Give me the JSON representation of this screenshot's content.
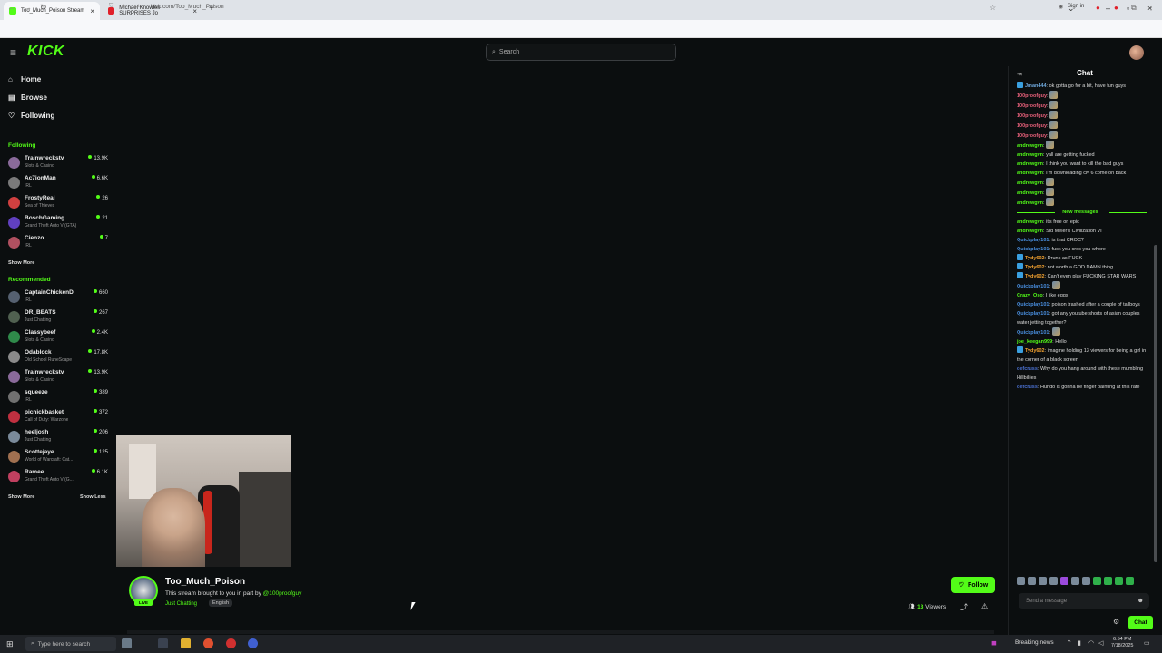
{
  "browser": {
    "tabs": [
      {
        "title": "Too_Much_Poison Stream",
        "favicon_color": "#53fc18",
        "active": true
      },
      {
        "title": "Michael Knowles SURPRISES Jo",
        "favicon_color": "#e0202a",
        "active": false
      }
    ],
    "new_tab": "+",
    "url": "kick.com/Too_Much_Poison",
    "sign_in": "Sign in"
  },
  "topnav": {
    "logo": "KICK",
    "search_placeholder": "Search"
  },
  "sidebar": {
    "nav": [
      {
        "label": "Home",
        "icon": "home-icon"
      },
      {
        "label": "Browse",
        "icon": "browse-icon"
      },
      {
        "label": "Following",
        "icon": "heart-icon"
      }
    ],
    "following_heading": "Following",
    "following": [
      {
        "name": "Trainwreckstv",
        "category": "Slots & Casino",
        "viewers": "13.9K",
        "color": "#8a6a9a"
      },
      {
        "name": "Ac7ionMan",
        "category": "IRL",
        "viewers": "6.6K",
        "color": "#7a7a7a"
      },
      {
        "name": "FrostyReal",
        "category": "Sea of Thieves",
        "viewers": "26",
        "color": "#d04040"
      },
      {
        "name": "BoschGaming",
        "category": "Grand Theft Auto V (GTA)",
        "viewers": "21",
        "color": "#6040c0"
      },
      {
        "name": "Cienzo",
        "category": "IRL",
        "viewers": "7",
        "color": "#b05060"
      }
    ],
    "following_show_more": "Show More",
    "recommended_heading": "Recommended",
    "recommended": [
      {
        "name": "CaptainChickenD",
        "category": "IRL",
        "viewers": "660",
        "color": "#556070"
      },
      {
        "name": "DR_BEATS",
        "category": "Just Chatting",
        "viewers": "267",
        "color": "#506050"
      },
      {
        "name": "Classybeef",
        "category": "Slots & Casino",
        "viewers": "2.4K",
        "color": "#2f8a4a"
      },
      {
        "name": "Odablock",
        "category": "Old School RuneScape",
        "viewers": "17.8K",
        "color": "#8a8a8a"
      },
      {
        "name": "Trainwreckstv",
        "category": "Slots & Casino",
        "viewers": "13.9K",
        "color": "#8a6a9a"
      },
      {
        "name": "squeeze",
        "category": "IRL",
        "viewers": "389",
        "color": "#707070"
      },
      {
        "name": "picnickbasket",
        "category": "Call of Duty: Warzone",
        "viewers": "372",
        "color": "#c03040"
      },
      {
        "name": "heeljosh",
        "category": "Just Chatting",
        "viewers": "206",
        "color": "#7a8a9a"
      },
      {
        "name": "Scottejaye",
        "category": "World of Warcraft: Cat...",
        "viewers": "125",
        "color": "#a07050"
      },
      {
        "name": "Ramee",
        "category": "Grand Theft Auto V (G...",
        "viewers": "6.1K",
        "color": "#c04060"
      }
    ],
    "recommended_show_more": "Show More",
    "recommended_show_less": "Show Less"
  },
  "stream": {
    "name": "Too_Much_Poison",
    "live": "LIVE",
    "title_prefix": "This stream brought to you in part by",
    "title_mention": "@100proofguy",
    "category": "Just Chatting",
    "language": "English",
    "follow_label": "Follow",
    "viewers_count": "13",
    "viewers_label": "Viewers"
  },
  "chat": {
    "title": "Chat",
    "messages": [
      {
        "user": "Jman444",
        "color": "#6fa8dc",
        "text": "ok gotta go for a bit, have fun guys",
        "badge": true
      },
      {
        "user": "100proofguy",
        "color": "#e8607a",
        "text": "",
        "emote": true
      },
      {
        "user": "100proofguy",
        "color": "#e8607a",
        "text": "",
        "emote": true
      },
      {
        "user": "100proofguy",
        "color": "#e8607a",
        "text": "",
        "emote": true
      },
      {
        "user": "100proofguy",
        "color": "#e8607a",
        "text": "",
        "emote": true
      },
      {
        "user": "100proofguy",
        "color": "#e8607a",
        "text": "",
        "emote": true
      },
      {
        "user": "andrewgvn",
        "color": "#53fc18",
        "text": "",
        "emote": true
      },
      {
        "user": "andrewgvn",
        "color": "#53fc18",
        "text": "yall are getting fucked"
      },
      {
        "user": "andrewgvn",
        "color": "#53fc18",
        "text": "I think you want to kill the bad guys"
      },
      {
        "user": "andrewgvn",
        "color": "#53fc18",
        "text": "I'm downloading civ 6 come on back"
      },
      {
        "user": "andrewgvn",
        "color": "#53fc18",
        "text": "",
        "emote": true
      },
      {
        "user": "andrewgvn",
        "color": "#53fc18",
        "text": "",
        "emote": true
      },
      {
        "user": "andrewgvn",
        "color": "#53fc18",
        "text": "",
        "emote": true
      }
    ],
    "new_messages_label": "New messages",
    "new_messages": [
      {
        "user": "andrewgvn",
        "color": "#53fc18",
        "text": "it's free on epic"
      },
      {
        "user": "andrewgvn",
        "color": "#53fc18",
        "text": "Sid Meier's Civilization VI"
      },
      {
        "user": "Quickplay101",
        "color": "#4a90e2",
        "text": "is that CROC?"
      },
      {
        "user": "Quickplay101",
        "color": "#4a90e2",
        "text": "fuck you croc you whore"
      },
      {
        "user": "Tydy602",
        "color": "#f0a030",
        "text": "Drunk as FUCK",
        "badge": true
      },
      {
        "user": "Tydy602",
        "color": "#f0a030",
        "text": "not worth a GOD DAMN thing",
        "badge": true
      },
      {
        "user": "Tydy602",
        "color": "#f0a030",
        "text": "Can't even play FUCKING STAR WARS",
        "badge": true
      },
      {
        "user": "Quickplay101",
        "color": "#4a90e2",
        "text": "",
        "emote": true
      },
      {
        "user": "Crazy_Oso",
        "color": "#53fc18",
        "text": "I like eggs"
      },
      {
        "user": "Quickplay101",
        "color": "#4a90e2",
        "text": "poison trashed after a couple of tallboys"
      },
      {
        "user": "Quickplay101",
        "color": "#4a90e2",
        "text": "got any youtube shorts of asian couples water jetting together?"
      },
      {
        "user": "Quickplay101",
        "color": "#4a90e2",
        "text": "",
        "emote": true
      },
      {
        "user": "joe_keegan999",
        "color": "#53fc18",
        "text": "Hello"
      },
      {
        "user": "Tydy602",
        "color": "#f0a030",
        "text": "imagine holding 13 viewers for being a girl in the corner of a black screen",
        "badge": true
      },
      {
        "user": "defcruss",
        "color": "#4a70d0",
        "text": "Why do you hang around with these mumbling Hillbillies"
      },
      {
        "user": "defcruss",
        "color": "#4a70d0",
        "text": "Hundo is gonna be finger painting at this rate"
      }
    ],
    "input_placeholder": "Send a message",
    "send_label": "Chat"
  },
  "taskbar": {
    "search_placeholder": "Type here to search",
    "news": "Breaking news",
    "time": "6:54 PM",
    "date": "7/18/2025"
  }
}
